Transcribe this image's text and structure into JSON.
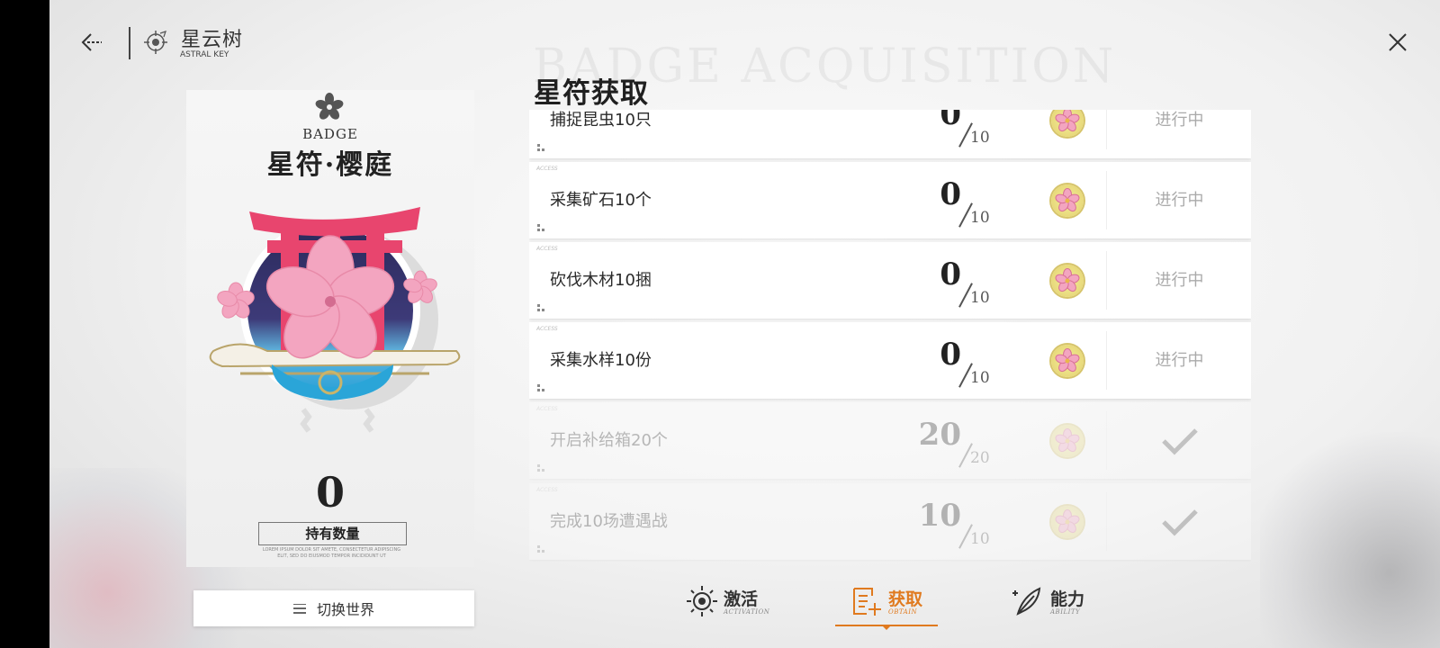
{
  "header": {
    "title": "星云树",
    "subtitle": "ASTRAL KEY"
  },
  "badge": {
    "caption": "BADGE",
    "name": "星符·樱庭",
    "count": "0",
    "count_label": "持有数量",
    "lorem": "LOREM IPSUM DOLOR SIT AMETE, CONSECTETUR ADIPISCING ELIT, SED DO EIUSMOD TEMPOR INCIDIDUNT UT"
  },
  "switch_world": {
    "label": "切换世界"
  },
  "section": {
    "title": "星符获取",
    "background_title": "BADGE ACQUISITION"
  },
  "tasks": [
    {
      "label": "捕捉昆虫10只",
      "current": "0",
      "total": "10",
      "status": "进行中",
      "done": false
    },
    {
      "label": "采集矿石10个",
      "current": "0",
      "total": "10",
      "status": "进行中",
      "done": false
    },
    {
      "label": "砍伐木材10捆",
      "current": "0",
      "total": "10",
      "status": "进行中",
      "done": false
    },
    {
      "label": "采集水样10份",
      "current": "0",
      "total": "10",
      "status": "进行中",
      "done": false
    },
    {
      "label": "开启补给箱20个",
      "current": "20",
      "total": "20",
      "status": "",
      "done": true
    },
    {
      "label": "完成10场遭遇战",
      "current": "10",
      "total": "10",
      "status": "",
      "done": true
    }
  ],
  "row_tag": "ACCESS",
  "tabs": [
    {
      "label": "激活",
      "sub": "ACTIVATION",
      "icon": "sun-gear-icon",
      "active": false
    },
    {
      "label": "获取",
      "sub": "OBTAIN",
      "icon": "list-add-icon",
      "active": true
    },
    {
      "label": "能力",
      "sub": "ABILITY",
      "icon": "feather-icon",
      "active": false
    }
  ],
  "colors": {
    "accent": "#e07a1f",
    "torii": "#e8456e",
    "sakura": "#f3a5c0",
    "coin": "#eadf86"
  }
}
